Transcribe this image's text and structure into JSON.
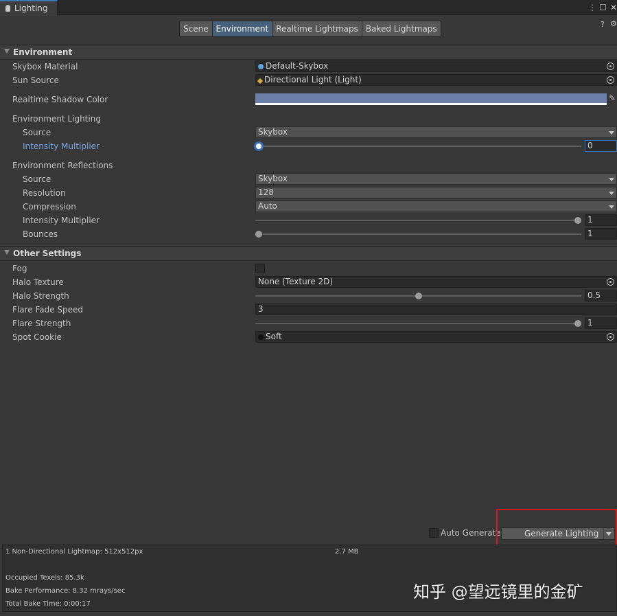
{
  "window": {
    "title": "Lighting"
  },
  "top_icons": {
    "kebab": "⋮",
    "maximize": "☐",
    "close": "✕"
  },
  "toolbar": {
    "tabs": [
      {
        "label": "Scene",
        "active": false
      },
      {
        "label": "Environment",
        "active": true
      },
      {
        "label": "Realtime Lightmaps",
        "active": false
      },
      {
        "label": "Baked Lightmaps",
        "active": false
      }
    ],
    "help_icon": "?",
    "settings_icon": "⚙"
  },
  "environment": {
    "header": "Environment",
    "skybox_material": {
      "label": "Skybox Material",
      "value": "Default-Skybox"
    },
    "sun_source": {
      "label": "Sun Source",
      "value": "Directional Light (Light)"
    },
    "realtime_shadow_color": {
      "label": "Realtime Shadow Color",
      "color": "#6b7fa8"
    },
    "lighting": {
      "label": "Environment Lighting",
      "source": {
        "label": "Source",
        "value": "Skybox"
      },
      "intensity": {
        "label": "Intensity Multiplier",
        "value": "0",
        "fraction": 0.0
      }
    },
    "reflections": {
      "label": "Environment Reflections",
      "source": {
        "label": "Source",
        "value": "Skybox"
      },
      "resolution": {
        "label": "Resolution",
        "value": "128"
      },
      "compression": {
        "label": "Compression",
        "value": "Auto"
      },
      "intensity": {
        "label": "Intensity Multiplier",
        "value": "1",
        "fraction": 1.0
      },
      "bounces": {
        "label": "Bounces",
        "value": "1",
        "fraction": 0.0
      }
    }
  },
  "other_settings": {
    "header": "Other Settings",
    "fog": {
      "label": "Fog",
      "checked": false
    },
    "halo_texture": {
      "label": "Halo Texture",
      "value": "None (Texture 2D)"
    },
    "halo_strength": {
      "label": "Halo Strength",
      "value": "0.5",
      "fraction": 0.5
    },
    "flare_fade_speed": {
      "label": "Flare Fade Speed",
      "value": "3"
    },
    "flare_strength": {
      "label": "Flare Strength",
      "value": "1",
      "fraction": 1.0
    },
    "spot_cookie": {
      "label": "Spot Cookie",
      "value": "Soft"
    }
  },
  "bottom": {
    "auto_generate": {
      "label": "Auto Generate",
      "checked": false
    },
    "generate_button": "Generate Lighting"
  },
  "stats": {
    "lightmap": "1 Non-Directional Lightmap: 512x512px",
    "size": "2.7 MB",
    "occupied_texels": "Occupied Texels: 85.3k",
    "bake_performance": "Bake Performance: 8.32 mrays/sec",
    "total_bake_time": "Total Bake Time: 0:00:17"
  },
  "watermark": "知乎 @望远镜里的金矿",
  "colors": {
    "accent": "#3a79bb",
    "active_tab": "#46607c",
    "highlight": "#d21c1c"
  }
}
